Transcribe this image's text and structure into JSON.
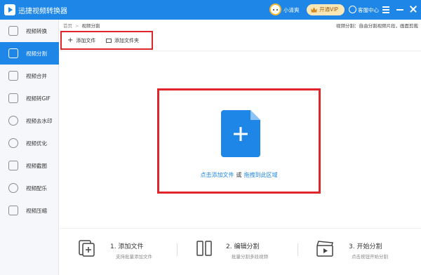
{
  "app": {
    "title": "迅捷视频转换器",
    "user_name": "小清爽",
    "vip_label": "开通VIP",
    "service_label": "客服中心"
  },
  "sidebar": {
    "items": [
      {
        "label": "视频转换",
        "icon": "convert-icon",
        "active": false
      },
      {
        "label": "视频分割",
        "icon": "split-icon",
        "active": true
      },
      {
        "label": "视频合并",
        "icon": "merge-icon",
        "active": false
      },
      {
        "label": "视频转GIF",
        "icon": "gif-icon",
        "active": false
      },
      {
        "label": "视频去水印",
        "icon": "watermark-icon",
        "active": false
      },
      {
        "label": "视频优化",
        "icon": "optimize-icon",
        "active": false
      },
      {
        "label": "视频截图",
        "icon": "screenshot-icon",
        "active": false
      },
      {
        "label": "视频配乐",
        "icon": "music-icon",
        "active": false
      },
      {
        "label": "视频压缩",
        "icon": "compress-icon",
        "active": false
      }
    ]
  },
  "breadcrumb": {
    "home": "首页",
    "current": "视频分割"
  },
  "hint": "视频分割：自由分割视频片段，画面剪裁",
  "toolbar": {
    "add_file": "添加文件",
    "add_folder": "添加文件夹"
  },
  "drop": {
    "click_add": "点击添加文件",
    "or": "或",
    "drag": "拖拽到此区域"
  },
  "steps": [
    {
      "title": "1. 添加文件",
      "desc": "支持批量添加文件",
      "icon": "add-file-icon"
    },
    {
      "title": "2. 编辑分割",
      "desc": "批量分割多段视频",
      "icon": "edit-split-icon"
    },
    {
      "title": "3. 开始分割",
      "desc": "点击按钮开始分割",
      "icon": "clapper-icon"
    }
  ],
  "colors": {
    "accent": "#1e86e6",
    "highlight_border": "#e0262b",
    "vip_bg": "#fbe7b5"
  }
}
